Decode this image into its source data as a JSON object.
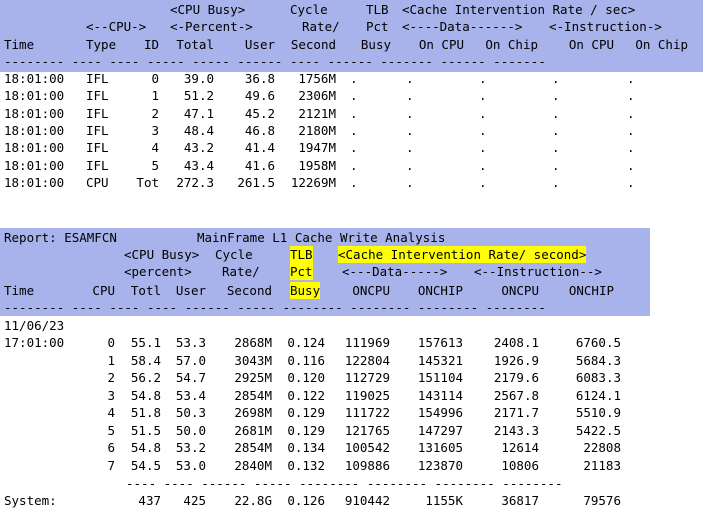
{
  "section1": {
    "header": {
      "r1": {
        "cpu_busy": "<CPU Busy>",
        "cycle": "Cycle",
        "tlb": "TLB",
        "cache": "<Cache Intervention Rate / sec>"
      },
      "r2": {
        "cpu": "<--CPU->",
        "percent": "<-Percent->",
        "rate": "Rate/",
        "pct": "Pct",
        "data": "<----Data------>",
        "instr": "<-Instruction->"
      },
      "r3": {
        "time": "Time",
        "type": "Type",
        "id": "ID",
        "total": "Total",
        "user": "User",
        "second": "Second",
        "busy": "Busy",
        "d_oncpu": "On CPU",
        "d_onchip": "On Chip",
        "i_oncpu": "On CPU",
        "i_onchip": "On Chip"
      },
      "underline": "-------- ---- ---- ----- ----- ------ ---- ------ ------- ------ -------"
    },
    "rows": [
      {
        "time": "18:01:00",
        "type": "IFL",
        "id": "0",
        "total": "39.0",
        "user": "36.8",
        "rate": "1756M",
        "busy": ".",
        "d1": ".",
        "d2": ".",
        "i1": ".",
        "i2": "."
      },
      {
        "time": "18:01:00",
        "type": "IFL",
        "id": "1",
        "total": "51.2",
        "user": "49.6",
        "rate": "2306M",
        "busy": ".",
        "d1": ".",
        "d2": ".",
        "i1": ".",
        "i2": "."
      },
      {
        "time": "18:01:00",
        "type": "IFL",
        "id": "2",
        "total": "47.1",
        "user": "45.2",
        "rate": "2121M",
        "busy": ".",
        "d1": ".",
        "d2": ".",
        "i1": ".",
        "i2": "."
      },
      {
        "time": "18:01:00",
        "type": "IFL",
        "id": "3",
        "total": "48.4",
        "user": "46.8",
        "rate": "2180M",
        "busy": ".",
        "d1": ".",
        "d2": ".",
        "i1": ".",
        "i2": "."
      },
      {
        "time": "18:01:00",
        "type": "IFL",
        "id": "4",
        "total": "43.2",
        "user": "41.4",
        "rate": "1947M",
        "busy": ".",
        "d1": ".",
        "d2": ".",
        "i1": ".",
        "i2": "."
      },
      {
        "time": "18:01:00",
        "type": "IFL",
        "id": "5",
        "total": "43.4",
        "user": "41.6",
        "rate": "1958M",
        "busy": ".",
        "d1": ".",
        "d2": ".",
        "i1": ".",
        "i2": "."
      },
      {
        "time": "18:01:00",
        "type": "CPU",
        "id": "Tot",
        "total": "272.3",
        "user": "261.5",
        "rate": "12269M",
        "busy": ".",
        "d1": ".",
        "d2": ".",
        "i1": ".",
        "i2": "."
      }
    ]
  },
  "section2": {
    "report_label": "Report: ESAMFCN",
    "report_title": "MainFrame L1 Cache Write Analysis",
    "header": {
      "r1": {
        "cpu_busy": "<CPU Busy>",
        "cycle": "Cycle",
        "tlb": "TLB",
        "cache": "<Cache Intervention Rate/ second>"
      },
      "r2": {
        "percent": "<percent>",
        "rate": "Rate/",
        "pct": "Pct",
        "data": "<---Data----->",
        "instr": "<--Instruction-->"
      },
      "r3": {
        "time": "Time",
        "cpu": "CPU",
        "totl": "Totl",
        "user": "User",
        "second": "Second",
        "busy": "Busy",
        "d_oncpu": "ONCPU",
        "d_onchip": "ONCHIP",
        "i_oncpu": "ONCPU",
        "i_onchip": "ONCHIP"
      },
      "underline": "-------- ---- ---- ---- ------ ----- -------- -------- -------- --------"
    },
    "date": "11/06/23",
    "time": "17:01:00",
    "rows": [
      {
        "cpu": "0",
        "totl": "55.1",
        "user": "53.3",
        "second": "2868M",
        "busy": "0.124",
        "d_oncpu": "111969",
        "d_onchip": "157613",
        "i_oncpu": "2408.1",
        "i_onchip": "6760.5"
      },
      {
        "cpu": "1",
        "totl": "58.4",
        "user": "57.0",
        "second": "3043M",
        "busy": "0.116",
        "d_oncpu": "122804",
        "d_onchip": "145321",
        "i_oncpu": "1926.9",
        "i_onchip": "5684.3"
      },
      {
        "cpu": "2",
        "totl": "56.2",
        "user": "54.7",
        "second": "2925M",
        "busy": "0.120",
        "d_oncpu": "112729",
        "d_onchip": "151104",
        "i_oncpu": "2179.6",
        "i_onchip": "6083.3"
      },
      {
        "cpu": "3",
        "totl": "54.8",
        "user": "53.4",
        "second": "2854M",
        "busy": "0.122",
        "d_oncpu": "119025",
        "d_onchip": "143114",
        "i_oncpu": "2567.8",
        "i_onchip": "6124.1"
      },
      {
        "cpu": "4",
        "totl": "51.8",
        "user": "50.3",
        "second": "2698M",
        "busy": "0.129",
        "d_oncpu": "111722",
        "d_onchip": "154996",
        "i_oncpu": "2171.7",
        "i_onchip": "5510.9"
      },
      {
        "cpu": "5",
        "totl": "51.5",
        "user": "50.0",
        "second": "2681M",
        "busy": "0.129",
        "d_oncpu": "121765",
        "d_onchip": "147297",
        "i_oncpu": "2143.3",
        "i_onchip": "5422.5"
      },
      {
        "cpu": "6",
        "totl": "54.8",
        "user": "53.2",
        "second": "2854M",
        "busy": "0.134",
        "d_oncpu": "100542",
        "d_onchip": "131605",
        "i_oncpu": "12614",
        "i_onchip": "22808"
      },
      {
        "cpu": "7",
        "totl": "54.5",
        "user": "53.0",
        "second": "2840M",
        "busy": "0.132",
        "d_oncpu": "109886",
        "d_onchip": "123870",
        "i_oncpu": "10806",
        "i_onchip": "21183"
      }
    ],
    "footer_underline": "---- ---- ------ ----- -------- -------- -------- --------",
    "system": {
      "label": "System:",
      "totl": "437",
      "user": "425",
      "second": "22.8G",
      "busy": "0.126",
      "d_oncpu": "910442",
      "d_onchip": "1155K",
      "i_oncpu": "36817",
      "i_onchip": "79576"
    }
  }
}
